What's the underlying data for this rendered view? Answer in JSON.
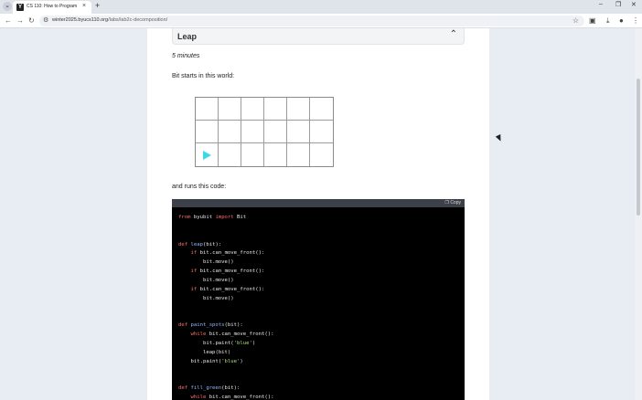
{
  "browser": {
    "tab_title": "CS 110: How to Program",
    "favicon_letter": "Y",
    "url_host": "winter2025.byucs110.org",
    "url_path": "/labs/lab2c-decomposition/",
    "icons": [
      "tab-dropdown-icon",
      "close-icon",
      "new-tab-icon",
      "back-icon",
      "forward-icon",
      "reload-icon",
      "site-info-icon",
      "star-icon",
      "extensions-icon",
      "download-icon",
      "profile-icon",
      "menu-icon"
    ]
  },
  "page": {
    "section_title": "Leap",
    "duration": "5 minutes",
    "intro": "Bit starts in this world:",
    "runs_text": "and runs this code:",
    "copy_label": "Copy",
    "world": {
      "cols": 6,
      "rows": 3,
      "bit_col": 0,
      "bit_row": 2,
      "bit_color": "#3bd8e6"
    }
  },
  "code_lines": [
    [
      "from byubit import Bit"
    ],
    [
      ""
    ],
    [
      ""
    ],
    [
      "def leap(bit):"
    ],
    [
      "    if bit.can_move_front():"
    ],
    [
      "        bit.move()"
    ],
    [
      "    if bit.can_move_front():"
    ],
    [
      "        bit.move()"
    ],
    [
      "    if bit.can_move_front():"
    ],
    [
      "        bit.move()"
    ],
    [
      ""
    ],
    [
      ""
    ],
    [
      "def paint_spots(bit):"
    ],
    [
      "    while bit.can_move_front():"
    ],
    [
      "        bit.paint('blue')"
    ],
    [
      "        leap(bit)"
    ],
    [
      "    bit.paint('blue')"
    ],
    [
      ""
    ],
    [
      ""
    ],
    [
      "def fill_green(bit):"
    ],
    [
      "    while bit.can_move_front():"
    ]
  ]
}
